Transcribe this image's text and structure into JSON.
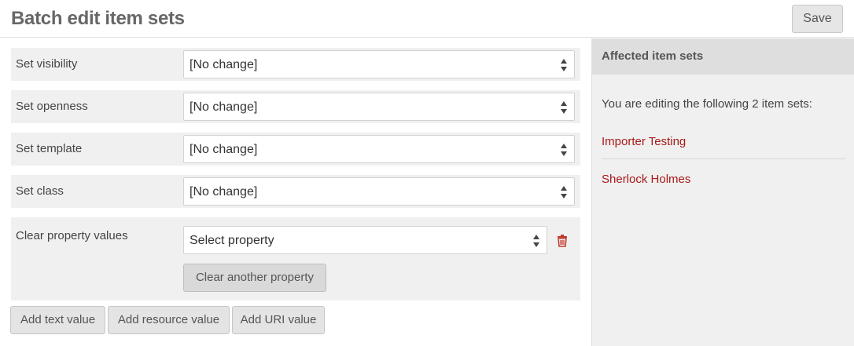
{
  "header": {
    "title": "Batch edit item sets",
    "save_label": "Save"
  },
  "fields": [
    {
      "label": "Set visibility",
      "value": "[No change]"
    },
    {
      "label": "Set openness",
      "value": "[No change]"
    },
    {
      "label": "Set template",
      "value": "[No change]"
    },
    {
      "label": "Set class",
      "value": "[No change]"
    }
  ],
  "clear_property": {
    "label": "Clear property values",
    "value": "Select property",
    "clear_another_label": "Clear another property"
  },
  "buttons": {
    "add_text": "Add text value",
    "add_resource": "Add resource value",
    "add_uri": "Add URI value"
  },
  "sidebar": {
    "title": "Affected item sets",
    "description": "You are editing the following 2 item sets:",
    "items": [
      "Importer Testing",
      "Sherlock Holmes"
    ]
  },
  "colors": {
    "link": "#a91919",
    "trash_icon": "#c0392b"
  }
}
